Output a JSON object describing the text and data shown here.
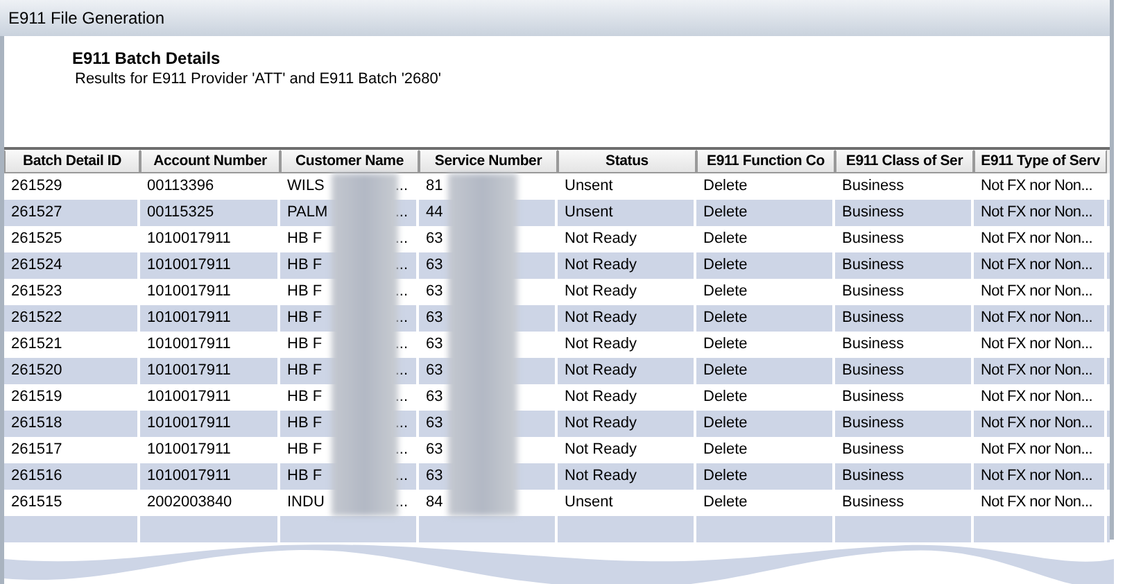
{
  "window": {
    "title": "E911 File Generation"
  },
  "heading": "E911 Batch Details",
  "subtitle": "Results for E911 Provider 'ATT' and E911 Batch '2680'",
  "table": {
    "columns": [
      "Batch Detail ID",
      "Account Number",
      "Customer Name",
      "Service Number",
      "Status",
      "E911 Function Co",
      "E911 Class of Ser",
      "E911 Type of Serv"
    ],
    "rows": [
      {
        "id": "261529",
        "account": "00113396",
        "customer": "WILS",
        "customer_end": "...",
        "service": "81",
        "status": "Unsent",
        "function": "Delete",
        "class": "Business",
        "type": "Not FX nor Non..."
      },
      {
        "id": "261527",
        "account": "00115325",
        "customer": "PALM",
        "customer_end": "...",
        "service": "44",
        "status": "Unsent",
        "function": "Delete",
        "class": "Business",
        "type": "Not FX nor Non..."
      },
      {
        "id": "261525",
        "account": "1010017911",
        "customer": "HB F",
        "customer_end": "...",
        "service": "63",
        "status": "Not Ready",
        "function": "Delete",
        "class": "Business",
        "type": "Not FX nor Non..."
      },
      {
        "id": "261524",
        "account": "1010017911",
        "customer": "HB F",
        "customer_end": "...",
        "service": "63",
        "status": "Not Ready",
        "function": "Delete",
        "class": "Business",
        "type": "Not FX nor Non..."
      },
      {
        "id": "261523",
        "account": "1010017911",
        "customer": "HB F",
        "customer_end": "...",
        "service": "63",
        "status": "Not Ready",
        "function": "Delete",
        "class": "Business",
        "type": "Not FX nor Non..."
      },
      {
        "id": "261522",
        "account": "1010017911",
        "customer": "HB F",
        "customer_end": "...",
        "service": "63",
        "status": "Not Ready",
        "function": "Delete",
        "class": "Business",
        "type": "Not FX nor Non..."
      },
      {
        "id": "261521",
        "account": "1010017911",
        "customer": "HB F",
        "customer_end": "...",
        "service": "63",
        "status": "Not Ready",
        "function": "Delete",
        "class": "Business",
        "type": "Not FX nor Non..."
      },
      {
        "id": "261520",
        "account": "1010017911",
        "customer": "HB F",
        "customer_end": "...",
        "service": "63",
        "status": "Not Ready",
        "function": "Delete",
        "class": "Business",
        "type": "Not FX nor Non..."
      },
      {
        "id": "261519",
        "account": "1010017911",
        "customer": "HB F",
        "customer_end": "...",
        "service": "63",
        "status": "Not Ready",
        "function": "Delete",
        "class": "Business",
        "type": "Not FX nor Non..."
      },
      {
        "id": "261518",
        "account": "1010017911",
        "customer": "HB F",
        "customer_end": "...",
        "service": "63",
        "status": "Not Ready",
        "function": "Delete",
        "class": "Business",
        "type": "Not FX nor Non..."
      },
      {
        "id": "261517",
        "account": "1010017911",
        "customer": "HB F",
        "customer_end": "...",
        "service": "63",
        "status": "Not Ready",
        "function": "Delete",
        "class": "Business",
        "type": "Not FX nor Non..."
      },
      {
        "id": "261516",
        "account": "1010017911",
        "customer": "HB F",
        "customer_end": "...",
        "service": "63",
        "status": "Not Ready",
        "function": "Delete",
        "class": "Business",
        "type": "Not FX nor Non..."
      },
      {
        "id": "261515",
        "account": "2002003840",
        "customer": "INDU",
        "customer_end": "...",
        "service": "84",
        "status": "Unsent",
        "function": "Delete",
        "class": "Business",
        "type": "Not FX nor Non..."
      }
    ]
  }
}
